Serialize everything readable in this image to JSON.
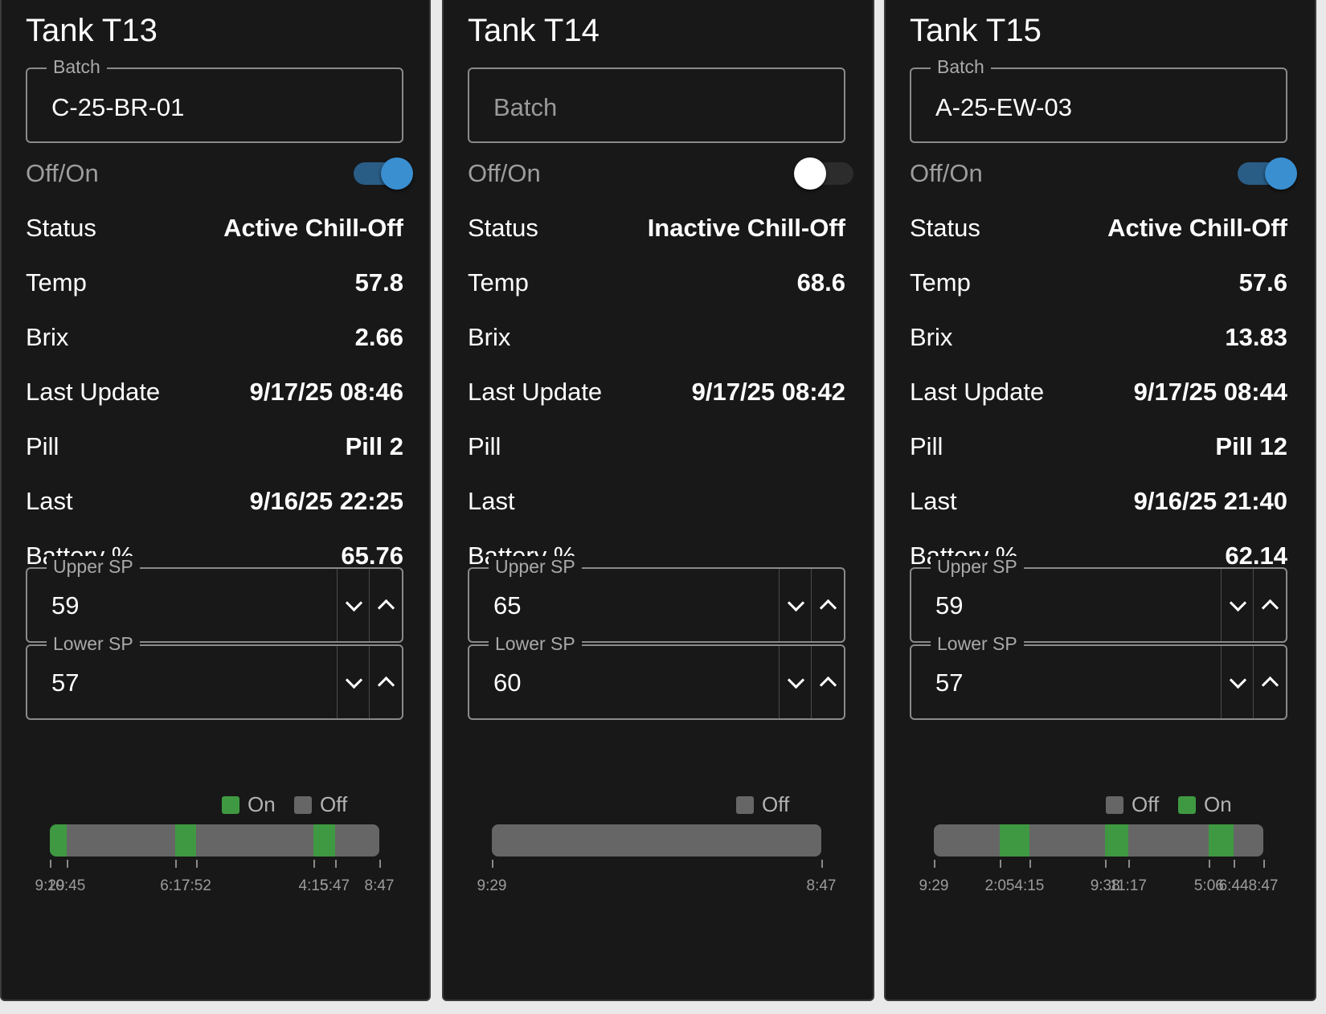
{
  "colors": {
    "on": "#3f9942",
    "off": "#666666",
    "accent": "#3a8fd1"
  },
  "panels": [
    {
      "title": "Tank T13",
      "batch": {
        "label": "Batch",
        "value": "C-25-BR-01",
        "placeholder": "Batch"
      },
      "switch": {
        "label": "Off/On",
        "on": true
      },
      "rows": [
        {
          "key": "Status",
          "value": "Active Chill-Off"
        },
        {
          "key": "Temp",
          "value": "57.8"
        },
        {
          "key": "Brix",
          "value": "2.66"
        },
        {
          "key": "Last Update",
          "value": "9/17/25 08:46"
        },
        {
          "key": "Pill",
          "value": "Pill 2"
        },
        {
          "key": "Last",
          "value": "9/16/25 22:25"
        },
        {
          "key": "Battery %",
          "value": "65.76"
        }
      ],
      "upper_sp": {
        "label": "Upper SP",
        "value": "59"
      },
      "lower_sp": {
        "label": "Lower SP",
        "value": "57"
      },
      "legend": [
        {
          "label": "On",
          "state": "on"
        },
        {
          "label": "Off",
          "state": "off"
        }
      ],
      "timeline": [
        {
          "state": "on",
          "from": 0.0,
          "to": 0.05
        },
        {
          "state": "off",
          "from": 0.05,
          "to": 0.38
        },
        {
          "state": "on",
          "from": 0.38,
          "to": 0.445
        },
        {
          "state": "off",
          "from": 0.445,
          "to": 0.8
        },
        {
          "state": "on",
          "from": 0.8,
          "to": 0.865
        },
        {
          "state": "off",
          "from": 0.865,
          "to": 1.0
        }
      ],
      "ticks": [
        {
          "at": 0.0,
          "label": "9:29"
        },
        {
          "at": 0.05,
          "label": "10:45"
        },
        {
          "at": 0.38,
          "label": "6:17"
        },
        {
          "at": 0.445,
          "label": "7:52"
        },
        {
          "at": 0.8,
          "label": "4:15"
        },
        {
          "at": 0.865,
          "label": "5:47"
        },
        {
          "at": 1.0,
          "label": "8:47"
        }
      ]
    },
    {
      "title": "Tank T14",
      "batch": {
        "label": "Batch",
        "value": "",
        "placeholder": "Batch"
      },
      "switch": {
        "label": "Off/On",
        "on": false
      },
      "rows": [
        {
          "key": "Status",
          "value": "Inactive Chill-Off"
        },
        {
          "key": "Temp",
          "value": "68.6"
        },
        {
          "key": "Brix",
          "value": ""
        },
        {
          "key": "Last Update",
          "value": "9/17/25 08:42"
        },
        {
          "key": "Pill",
          "value": ""
        },
        {
          "key": "Last",
          "value": ""
        },
        {
          "key": "Battery %",
          "value": ""
        }
      ],
      "upper_sp": {
        "label": "Upper SP",
        "value": "65"
      },
      "lower_sp": {
        "label": "Lower SP",
        "value": "60"
      },
      "legend": [
        {
          "label": "Off",
          "state": "off"
        }
      ],
      "timeline": [
        {
          "state": "off",
          "from": 0.0,
          "to": 1.0
        }
      ],
      "ticks": [
        {
          "at": 0.0,
          "label": "9:29"
        },
        {
          "at": 1.0,
          "label": "8:47"
        }
      ]
    },
    {
      "title": "Tank T15",
      "batch": {
        "label": "Batch",
        "value": "A-25-EW-03",
        "placeholder": "Batch"
      },
      "switch": {
        "label": "Off/On",
        "on": true
      },
      "rows": [
        {
          "key": "Status",
          "value": "Active Chill-Off"
        },
        {
          "key": "Temp",
          "value": "57.6"
        },
        {
          "key": "Brix",
          "value": "13.83"
        },
        {
          "key": "Last Update",
          "value": "9/17/25 08:44"
        },
        {
          "key": "Pill",
          "value": "Pill 12"
        },
        {
          "key": "Last",
          "value": "9/16/25 21:40"
        },
        {
          "key": "Battery %",
          "value": "62.14"
        }
      ],
      "upper_sp": {
        "label": "Upper SP",
        "value": "59"
      },
      "lower_sp": {
        "label": "Lower SP",
        "value": "57"
      },
      "legend": [
        {
          "label": "Off",
          "state": "off"
        },
        {
          "label": "On",
          "state": "on"
        }
      ],
      "timeline": [
        {
          "state": "off",
          "from": 0.0,
          "to": 0.2
        },
        {
          "state": "on",
          "from": 0.2,
          "to": 0.29
        },
        {
          "state": "off",
          "from": 0.29,
          "to": 0.52
        },
        {
          "state": "on",
          "from": 0.52,
          "to": 0.59
        },
        {
          "state": "off",
          "from": 0.59,
          "to": 0.835
        },
        {
          "state": "on",
          "from": 0.835,
          "to": 0.91
        },
        {
          "state": "off",
          "from": 0.91,
          "to": 1.0
        }
      ],
      "ticks": [
        {
          "at": 0.0,
          "label": "9:29"
        },
        {
          "at": 0.2,
          "label": "2:05"
        },
        {
          "at": 0.29,
          "label": "4:15"
        },
        {
          "at": 0.52,
          "label": "9:38"
        },
        {
          "at": 0.59,
          "label": "11:17"
        },
        {
          "at": 0.835,
          "label": "5:06"
        },
        {
          "at": 0.91,
          "label": "6:44"
        },
        {
          "at": 1.0,
          "label": "8:47"
        }
      ]
    }
  ]
}
